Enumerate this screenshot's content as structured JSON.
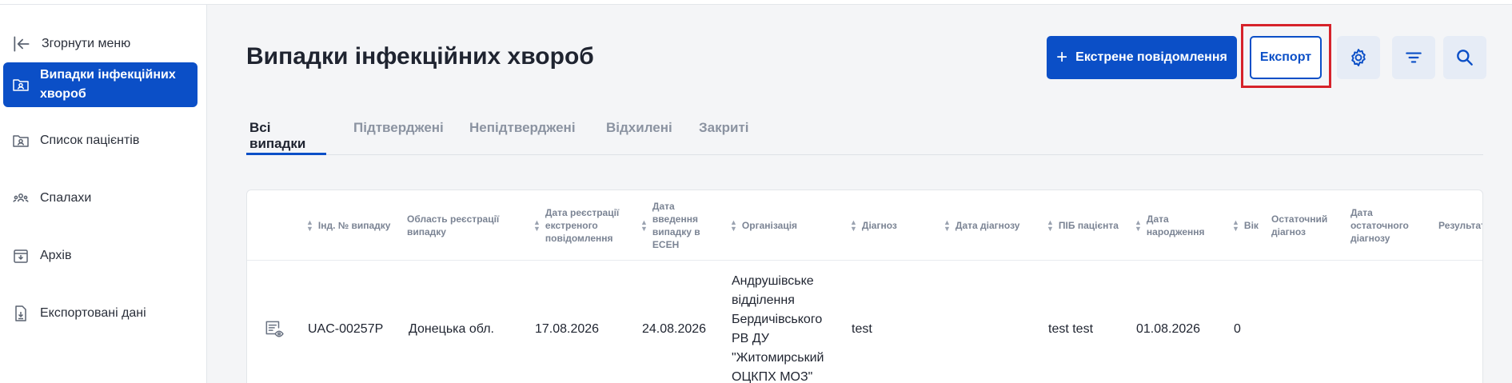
{
  "sidebar": {
    "collapse_label": "Згорнути меню",
    "items": [
      {
        "label": "Випадки інфекційних хвороб",
        "icon": "folder-user-icon",
        "active": true
      },
      {
        "label": "Список пацієнтів",
        "icon": "folder-list-icon",
        "active": false
      },
      {
        "label": "Спалахи",
        "icon": "people-group-icon",
        "active": false
      },
      {
        "label": "Архів",
        "icon": "archive-icon",
        "active": false
      },
      {
        "label": "Експортовані дані",
        "icon": "file-download-icon",
        "active": false
      }
    ]
  },
  "header": {
    "title": "Випадки інфекційних хвороб",
    "emergency_button": "Екстрене повідомлення",
    "export_button": "Експорт",
    "icons": [
      "gear-icon",
      "filter-icon",
      "search-icon"
    ]
  },
  "tabs": [
    {
      "label": "Всі випадки",
      "active": true
    },
    {
      "label": "Підтверджені",
      "active": false
    },
    {
      "label": "Непідтверджені",
      "active": false
    },
    {
      "label": "Відхилені",
      "active": false
    },
    {
      "label": "Закриті",
      "active": false
    }
  ],
  "table": {
    "columns": [
      "Інд. № випадку",
      "Область реєстрації випадку",
      "Дата реєстрації екстреного повідомлення",
      "Дата введення випадку в ЕСЕН",
      "Організація",
      "Діагноз",
      "Дата діагнозу",
      "ПІБ пацієнта",
      "Дата народження",
      "Вік",
      "Остаточний діагноз",
      "Дата остаточного діагнозу",
      "Результат"
    ],
    "rows": [
      {
        "case_id": "UAC-00257P",
        "region": "Донецька обл.",
        "registration_date": "17.08.2026",
        "entry_date": "24.08.2026",
        "organization": "Андрушівське відділення Бердичівського РВ ДУ \"Житомирський ОЦКПХ МОЗ\"",
        "diagnosis": "test",
        "diagnosis_date": "",
        "patient_name": "test test",
        "birth_date": "01.08.2026",
        "age": "0",
        "final_diagnosis": "",
        "final_diagnosis_date": "",
        "result": ""
      }
    ]
  },
  "colors": {
    "primary": "#0b4fc7",
    "highlight": "#d6222a"
  }
}
